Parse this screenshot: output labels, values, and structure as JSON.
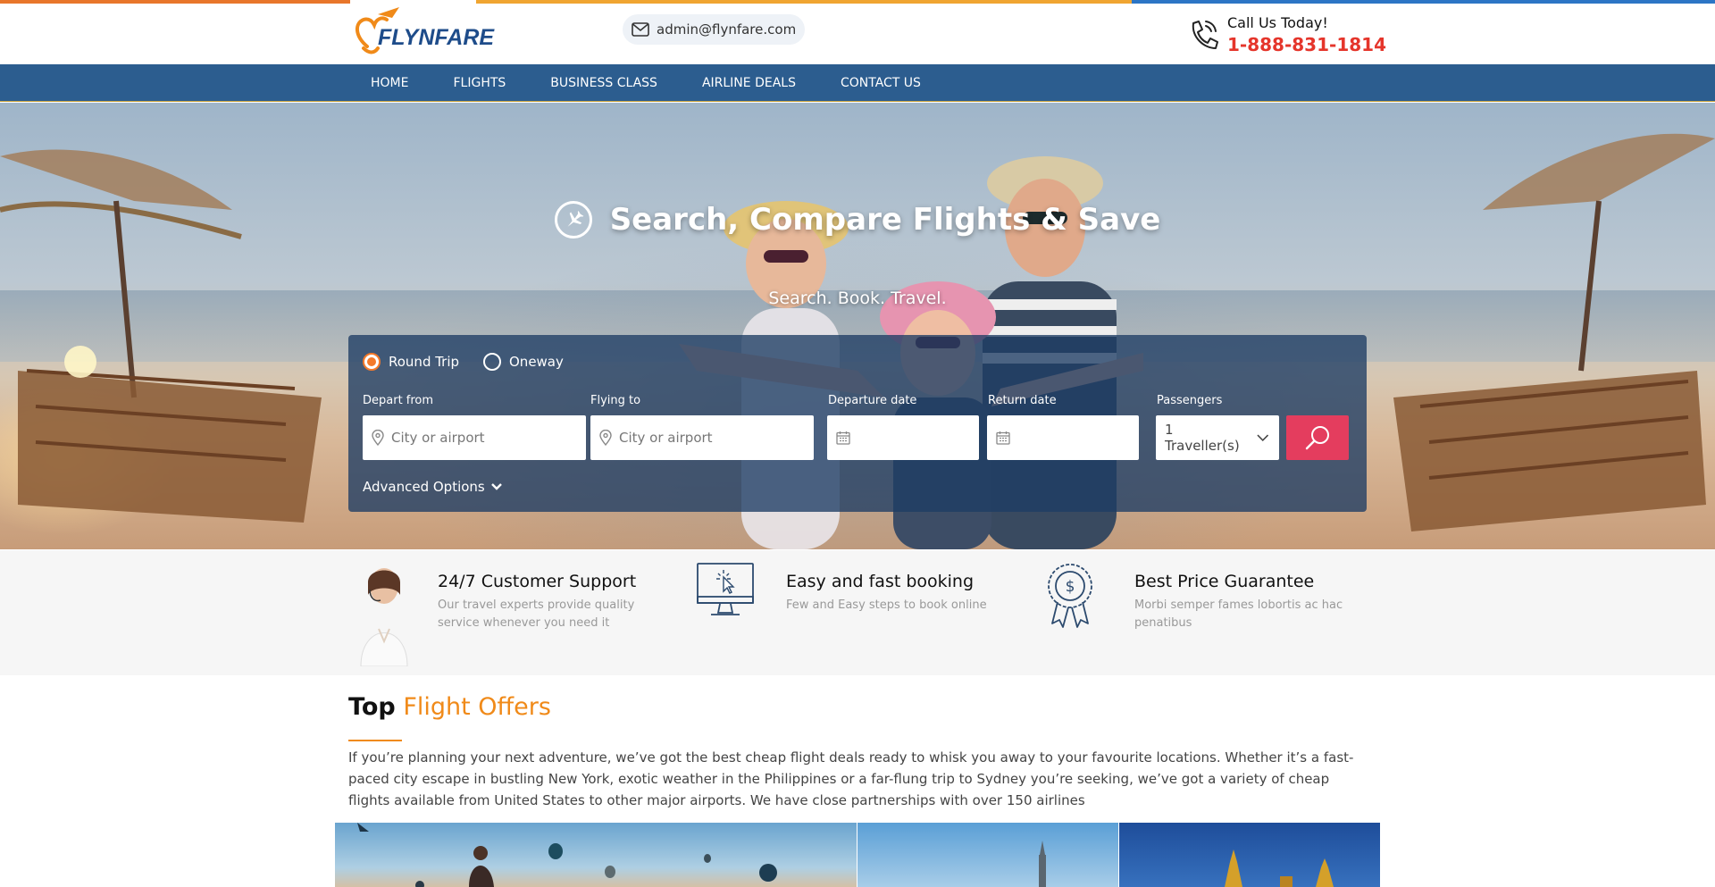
{
  "brand": {
    "name": "FLYNFARE"
  },
  "header": {
    "email": "admin@flynfare.com",
    "call_label": "Call Us Today!",
    "call_number": "1-888-831-1814"
  },
  "nav": {
    "items": [
      {
        "label": "HOME"
      },
      {
        "label": "FLIGHTS"
      },
      {
        "label": "BUSINESS CLASS"
      },
      {
        "label": "AIRLINE DEALS"
      },
      {
        "label": "CONTACT US"
      }
    ]
  },
  "hero": {
    "title": "Search, Compare Flights & Save",
    "subtitle": "Search. Book. Travel."
  },
  "search": {
    "trip_types": [
      {
        "label": "Round Trip",
        "selected": true
      },
      {
        "label": "Oneway",
        "selected": false
      }
    ],
    "depart_label": "Depart from",
    "depart_placeholder": "City or airport",
    "to_label": "Flying to",
    "to_placeholder": "City or airport",
    "departure_date_label": "Departure date",
    "return_date_label": "Return date",
    "passengers_label": "Passengers",
    "passengers_value": "1 Traveller(s)",
    "advanced_label": "Advanced Options"
  },
  "features": [
    {
      "title": "24/7 Customer Support",
      "desc": "Our travel experts provide quality service whenever you need it",
      "icon": "support-agent-icon"
    },
    {
      "title": "Easy and fast booking",
      "desc": "Few and Easy steps to book online",
      "icon": "computer-click-icon"
    },
    {
      "title": "Best Price Guarantee",
      "desc": "Morbi semper fames lobortis ac hac penatibus",
      "icon": "price-badge-icon"
    }
  ],
  "offers": {
    "title_bold": "Top",
    "title_accent": "Flight Offers",
    "text": "If you’re planning your next adventure, we’ve got the best cheap flight deals ready to whisk you away to your favourite locations. Whether it’s a fast-paced city escape in bustling New York, exotic weather in the Philippines or a far-flung trip to Sydney you’re seeking, we’ve got a variety of cheap flights available from United States to other major airports. We have close partnerships with over 150 airlines"
  },
  "colors": {
    "nav_bg": "#2c5d8f",
    "accent_orange": "#f08a19",
    "phone_red": "#e5352b",
    "search_button": "#e43d5e"
  }
}
